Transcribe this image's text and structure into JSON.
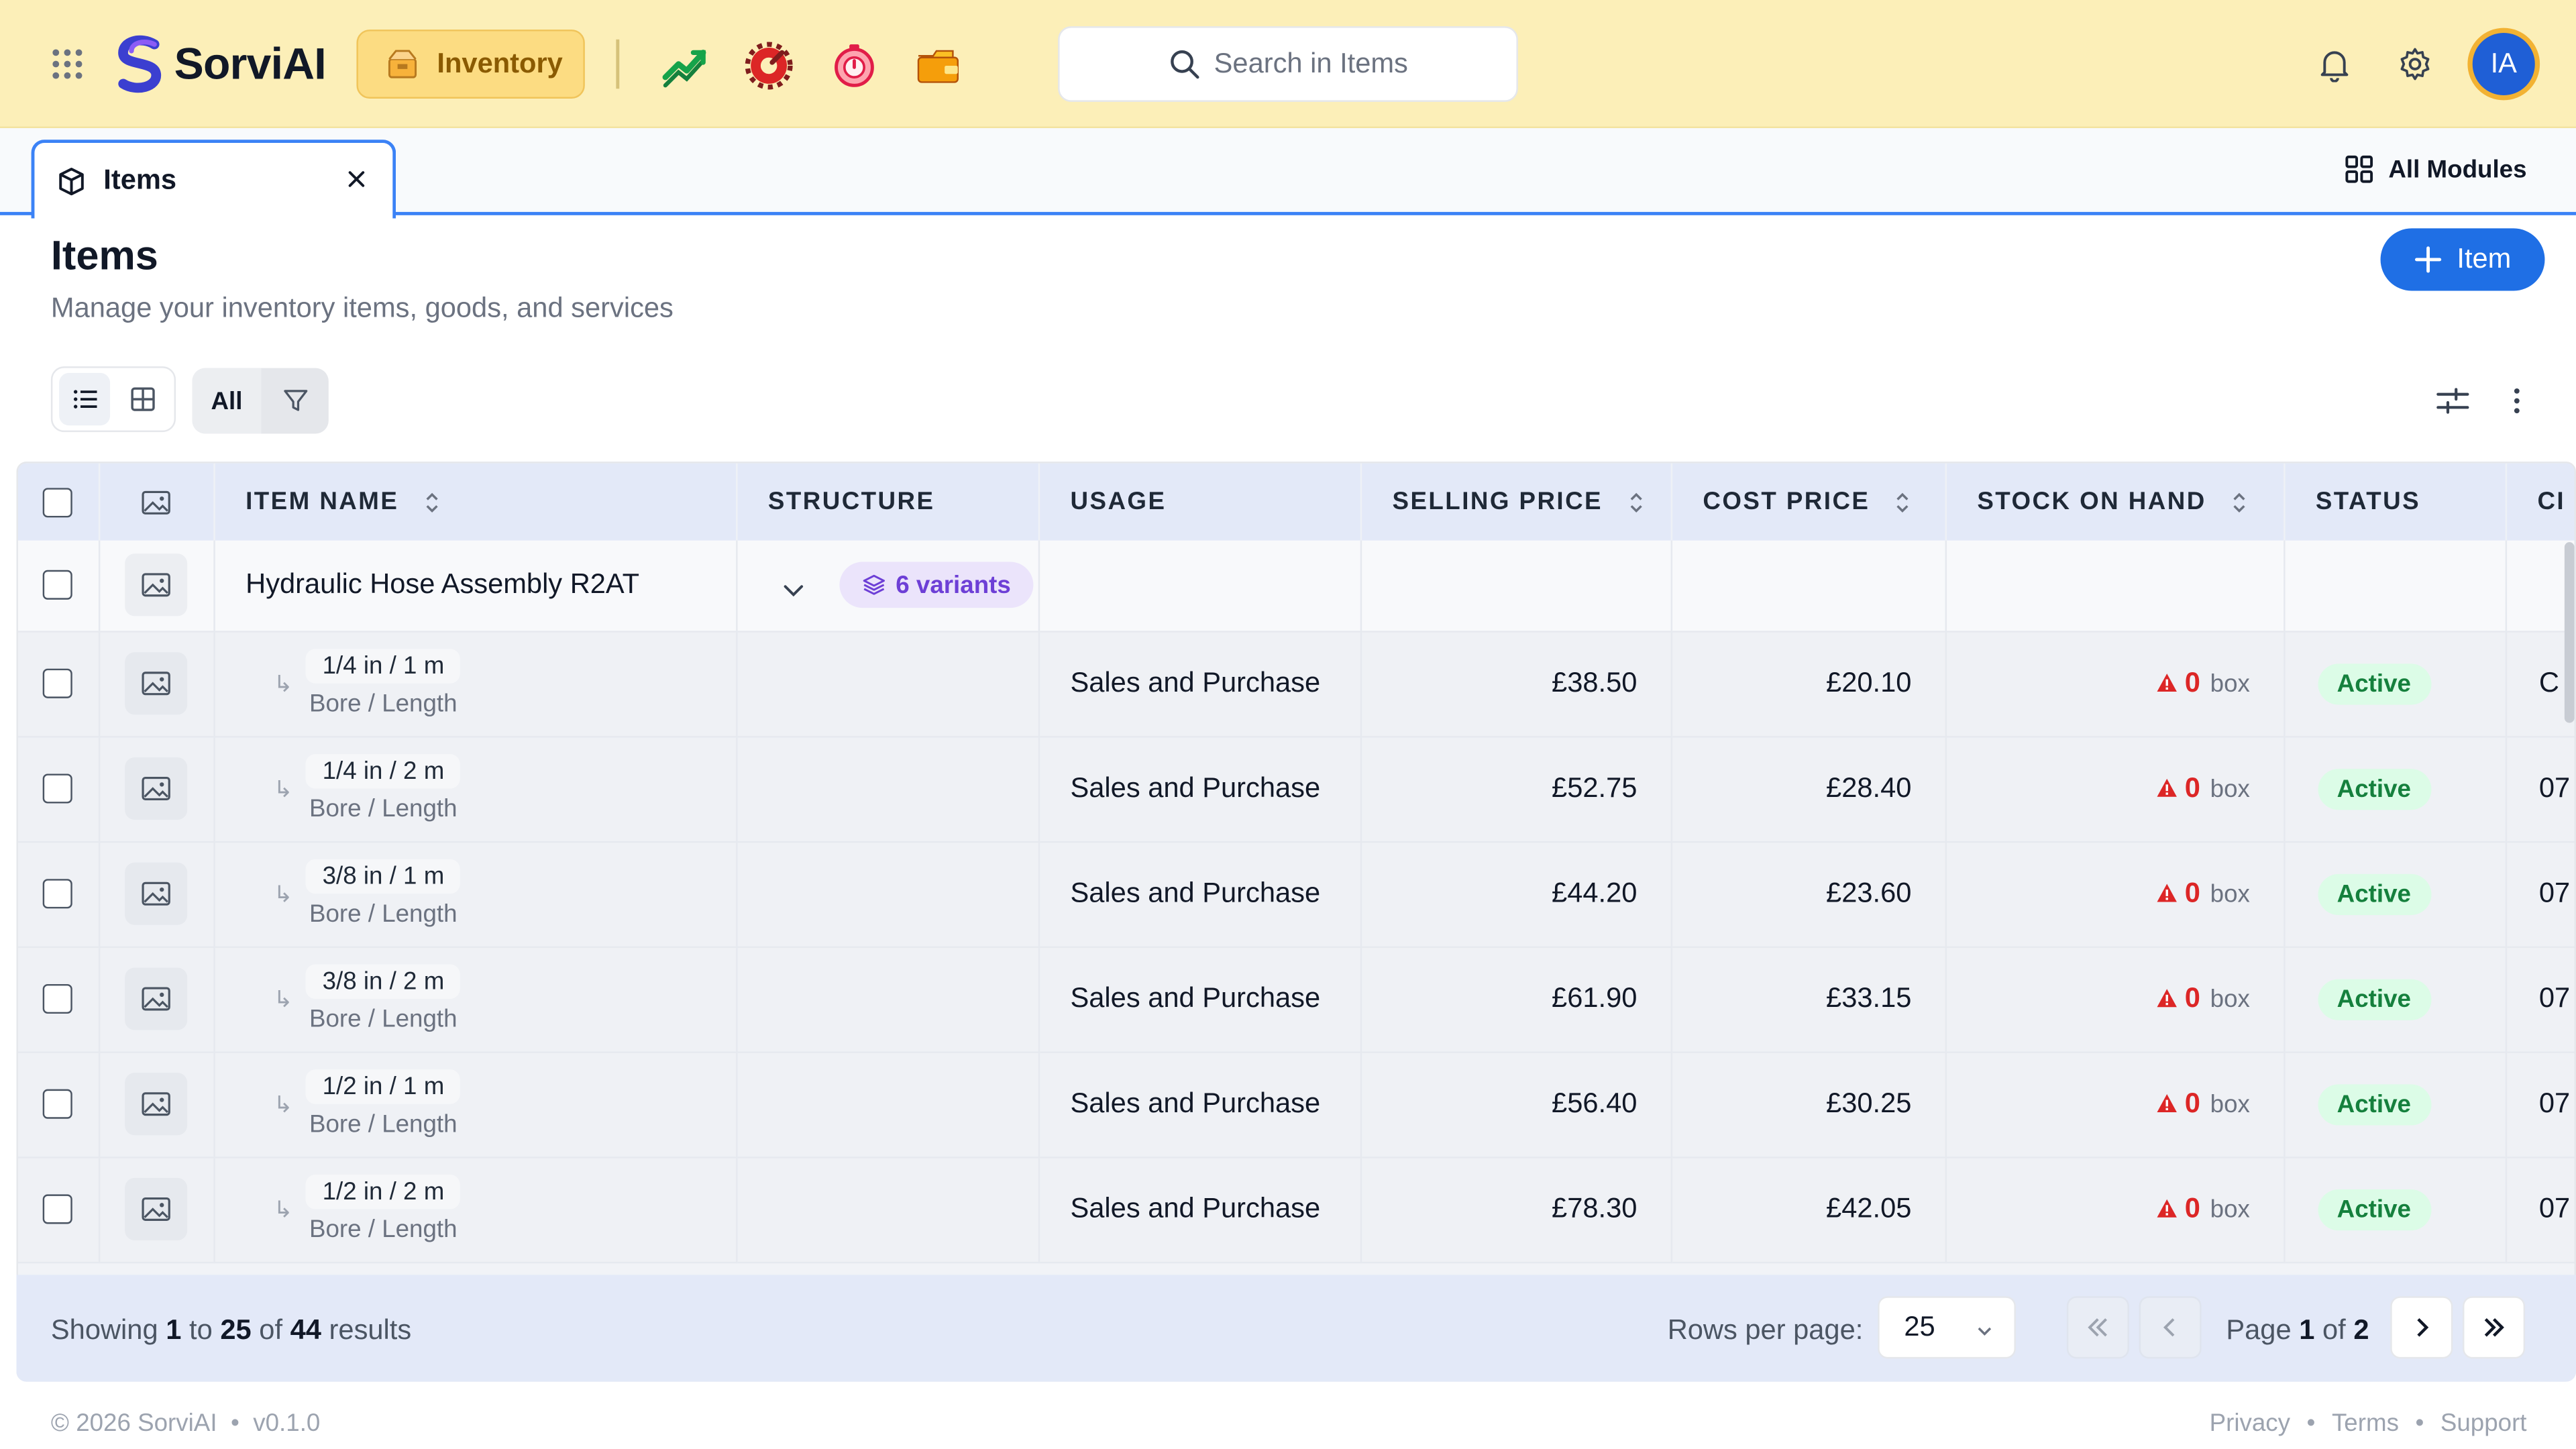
{
  "app": {
    "brand": "SorviAI",
    "module_pill": "Inventory",
    "search_placeholder": "Search in Items",
    "avatar_initials": "IA",
    "colors": {
      "accent": "#1f6fe5",
      "header_bg": "#fcefb8",
      "pill_bg": "#fcdc82"
    }
  },
  "tabs": {
    "active_label": "Items",
    "all_modules_label": "All Modules"
  },
  "page": {
    "title": "Items",
    "subtitle": "Manage your inventory items, goods, and services",
    "add_button_label": "Item"
  },
  "toolbar": {
    "filter_label": "All"
  },
  "table": {
    "columns": {
      "item_name": "ITEM NAME",
      "structure": "STRUCTURE",
      "usage": "USAGE",
      "selling_price": "SELLING PRICE",
      "cost_price": "COST PRICE",
      "stock_on_hand": "STOCK ON HAND",
      "status": "STATUS",
      "extra": "CI"
    },
    "parent": {
      "name": "Hydraulic Hose Assembly R2AT",
      "variants_badge": "6 variants"
    },
    "variants": [
      {
        "name": "1/4 in / 1 m",
        "attrs": "Bore / Length",
        "usage": "Sales and Purchase",
        "selling": "£38.50",
        "cost": "£20.10",
        "stock": "0",
        "unit": "box",
        "status": "Active",
        "extra": "C"
      },
      {
        "name": "1/4 in / 2 m",
        "attrs": "Bore / Length",
        "usage": "Sales and Purchase",
        "selling": "£52.75",
        "cost": "£28.40",
        "stock": "0",
        "unit": "box",
        "status": "Active",
        "extra": "07"
      },
      {
        "name": "3/8 in / 1 m",
        "attrs": "Bore / Length",
        "usage": "Sales and Purchase",
        "selling": "£44.20",
        "cost": "£23.60",
        "stock": "0",
        "unit": "box",
        "status": "Active",
        "extra": "07"
      },
      {
        "name": "3/8 in / 2 m",
        "attrs": "Bore / Length",
        "usage": "Sales and Purchase",
        "selling": "£61.90",
        "cost": "£33.15",
        "stock": "0",
        "unit": "box",
        "status": "Active",
        "extra": "07"
      },
      {
        "name": "1/2 in / 1 m",
        "attrs": "Bore / Length",
        "usage": "Sales and Purchase",
        "selling": "£56.40",
        "cost": "£30.25",
        "stock": "0",
        "unit": "box",
        "status": "Active",
        "extra": "07"
      },
      {
        "name": "1/2 in / 2 m",
        "attrs": "Bore / Length",
        "usage": "Sales and Purchase",
        "selling": "£78.30",
        "cost": "£42.05",
        "stock": "0",
        "unit": "box",
        "status": "Active",
        "extra": "07"
      }
    ]
  },
  "pagination": {
    "showing_prefix": "Showing",
    "from": "1",
    "to_word": "to",
    "to": "25",
    "of_word": "of",
    "total": "44",
    "results_word": "results",
    "rows_per_page_label": "Rows per page:",
    "rows_per_page": "25",
    "page_word": "Page",
    "current_page": "1",
    "page_of_word": "of",
    "total_pages": "2"
  },
  "footer": {
    "copyright": "© 2026 SorviAI",
    "version": "v0.1.0",
    "links": [
      "Privacy",
      "Terms",
      "Support"
    ]
  }
}
